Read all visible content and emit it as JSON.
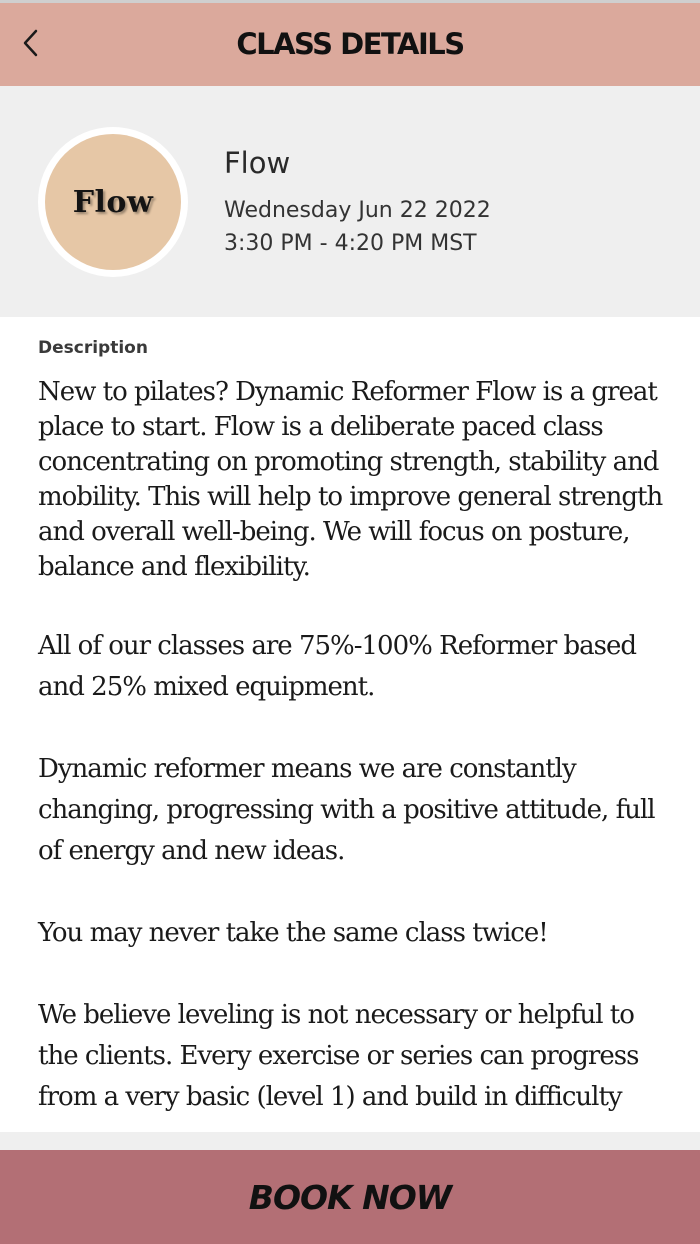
{
  "topbar": {
    "title": "CLASS DETAILS",
    "back_icon": "chevron-left-icon",
    "background": "#dba99c"
  },
  "class": {
    "avatar_text": "Flow",
    "avatar_color": "#e6c7a6",
    "name": "Flow",
    "date": "Wednesday Jun 22 2022",
    "time": "3:30 PM - 4:20 PM MST"
  },
  "description": {
    "label": "Description",
    "paragraphs": [
      "New to pilates? Dynamic Reformer Flow is a great place to start. Flow is a deliberate paced class concentrating on promoting strength, stability and mobility. This will help to improve general strength and overall well-being. We will focus on posture, balance and flexibility.",
      "All of our classes are 75%-100% Reformer based and 25% mixed equipment.",
      "Dynamic reformer means we are constantly changing, progressing with a positive attitude, full of energy and new ideas.",
      "You may never take the same class twice!",
      "We believe leveling is not necessary or helpful to the clients. Every exercise or series can progress from a very basic (level 1) and build in difficulty"
    ]
  },
  "book_button": {
    "label": "BOOK NOW",
    "background": "#b36f75"
  }
}
